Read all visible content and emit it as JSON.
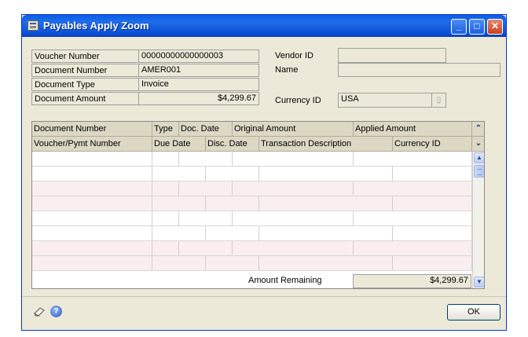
{
  "window": {
    "title": "Payables Apply Zoom",
    "buttons": {
      "minimize": "_",
      "maximize": "□",
      "close": "✕"
    }
  },
  "header": {
    "voucher_number": {
      "label": "Voucher Number",
      "value": "00000000000000003"
    },
    "document_number": {
      "label": "Document Number",
      "value": "AMER001"
    },
    "document_type": {
      "label": "Document Type",
      "value": "Invoice"
    },
    "document_amount": {
      "label": "Document Amount",
      "value": "$4,299.67"
    },
    "vendor_id": {
      "label": "Vendor ID",
      "value": ""
    },
    "name": {
      "label": "Name",
      "value": ""
    },
    "currency_id": {
      "label": "Currency ID",
      "value": "USA",
      "lookup_icon": "lookup-icon"
    }
  },
  "grid": {
    "header_row1": [
      "Document Number",
      "Type",
      "Doc. Date",
      "Original Amount",
      "Applied Amount"
    ],
    "header_row2": [
      "Voucher/Pymt Number",
      "Due Date",
      "Disc. Date",
      "Transaction Description",
      "Currency ID"
    ],
    "expand_icon": "double-chevron-up-icon",
    "collapse_icon": "double-chevron-down-icon",
    "rows": [
      {
        "pink": false
      },
      {
        "pink": false
      },
      {
        "pink": true
      },
      {
        "pink": true
      },
      {
        "pink": false
      },
      {
        "pink": false
      },
      {
        "pink": true
      },
      {
        "pink": true
      }
    ]
  },
  "footer": {
    "amount_remaining_label": "Amount Remaining",
    "amount_remaining_value": "$4,299.67",
    "ok_label": "OK",
    "icons": [
      "note-icon",
      "help-icon"
    ]
  }
}
